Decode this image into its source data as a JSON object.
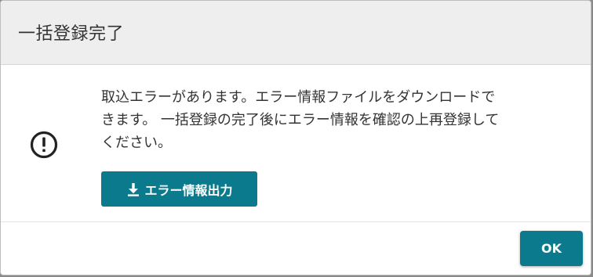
{
  "dialog": {
    "title": "一括登録完了",
    "message_lines": [
      "取込エラーがあります。エラー情報ファイルをダウンロードで",
      "きます。 一括登録の完了後にエラー情報を確認の上再登録して",
      "ください。"
    ],
    "alert_icon": "exclamation-circle-icon",
    "download_button_label": "エラー情報出力",
    "download_icon": "download-icon",
    "ok_button_label": "OK"
  },
  "colors": {
    "accent": "#0b7a8c",
    "header_bg": "#eeeeee",
    "text": "#333333"
  }
}
